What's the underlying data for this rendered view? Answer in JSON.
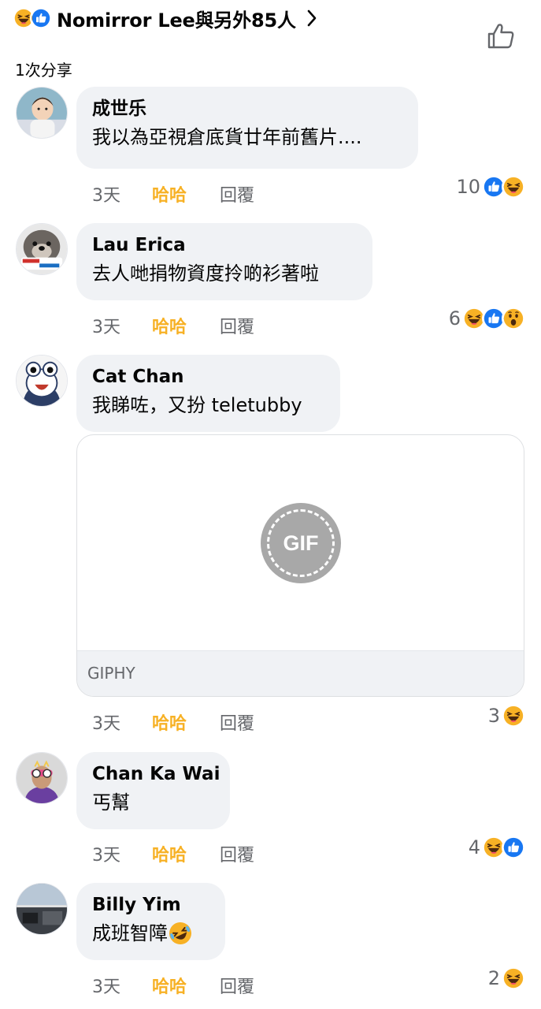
{
  "header": {
    "reactors_text": "Nomirror Lee與另外85人",
    "reaction_icons": [
      "haha-icon",
      "like-icon"
    ],
    "share_count": "1次分享"
  },
  "colors": {
    "like_blue": "#1877f2",
    "haha_yellow": "#f7b125",
    "wow_yellow": "#f7b125",
    "bubble_gray": "#f0f2f5",
    "meta_gray": "#65676b"
  },
  "labels": {
    "haha": "哈哈",
    "reply": "回覆"
  },
  "comments": [
    {
      "author": "成世乐",
      "text": "我以為亞視倉底貨廿年前舊片....",
      "time": "3天",
      "reaction_count": "10",
      "reaction_icons": [
        "like-icon",
        "haha-icon"
      ]
    },
    {
      "author": "Lau Erica",
      "text": "去人哋捐物資度拎啲衫著啦",
      "time": "3天",
      "reaction_count": "6",
      "reaction_icons": [
        "haha-icon",
        "like-icon",
        "wow-icon"
      ]
    },
    {
      "author": "Cat Chan",
      "text": "我睇咗，又扮 teletubby",
      "time": "3天",
      "reaction_count": "3",
      "reaction_icons": [
        "haha-icon"
      ],
      "gif": {
        "badge": "GIF",
        "source": "GIPHY"
      }
    },
    {
      "author": "Chan Ka Wai",
      "text": "丐幫",
      "time": "3天",
      "reaction_count": "4",
      "reaction_icons": [
        "haha-icon",
        "like-icon"
      ]
    },
    {
      "author": "Billy Yim",
      "text": "成班智障",
      "text_emoji": "rolling-laughing-icon",
      "time": "3天",
      "reaction_count": "2",
      "reaction_icons": [
        "haha-icon"
      ]
    }
  ]
}
